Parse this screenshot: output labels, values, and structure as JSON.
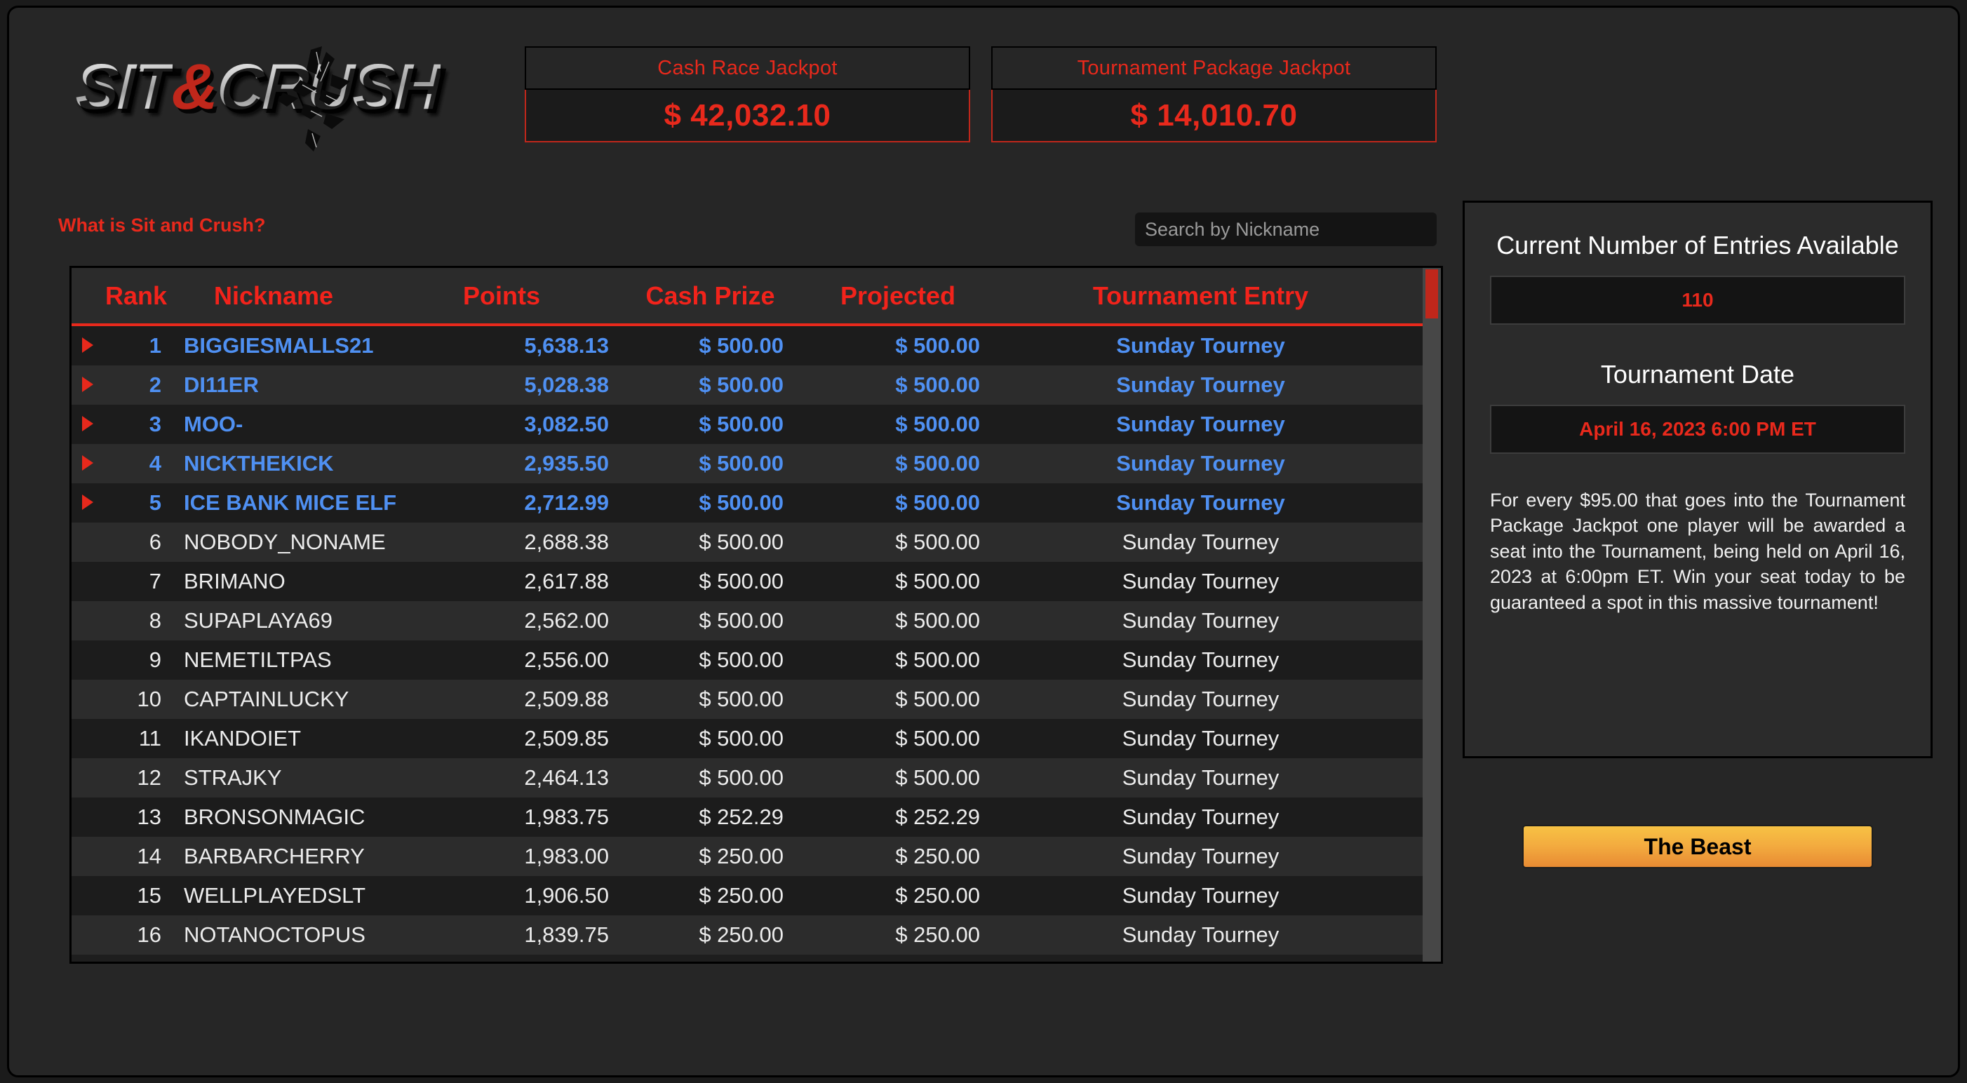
{
  "brand": {
    "logo_part1": "SIT",
    "logo_amp": "&",
    "logo_part2": "CRUSH",
    "logo_alt": "Sit & Crush"
  },
  "jackpots": {
    "cash": {
      "label": "Cash Race Jackpot",
      "value": "$ 42,032.10"
    },
    "tournament": {
      "label": "Tournament Package Jackpot",
      "value": "$ 14,010.70"
    }
  },
  "subbar": {
    "what_link": "What is Sit and Crush?",
    "search_placeholder": "Search by Nickname",
    "search_value": ""
  },
  "leaderboard": {
    "headers": {
      "rank": "Rank",
      "nickname": "Nickname",
      "points": "Points",
      "cash_prize": "Cash Prize",
      "projected": "Projected",
      "tournament_entry": "Tournament Entry"
    },
    "rows": [
      {
        "rank": "1",
        "nickname": "BIGGIESMALLS21",
        "points": "5,638.13",
        "cash": "$ 500.00",
        "projected": "$ 500.00",
        "entry": "Sunday Tourney",
        "highlight": true
      },
      {
        "rank": "2",
        "nickname": "DI11ER",
        "points": "5,028.38",
        "cash": "$ 500.00",
        "projected": "$ 500.00",
        "entry": "Sunday Tourney",
        "highlight": true
      },
      {
        "rank": "3",
        "nickname": "MOO-",
        "points": "3,082.50",
        "cash": "$ 500.00",
        "projected": "$ 500.00",
        "entry": "Sunday Tourney",
        "highlight": true
      },
      {
        "rank": "4",
        "nickname": "NICKTHEKICK",
        "points": "2,935.50",
        "cash": "$ 500.00",
        "projected": "$ 500.00",
        "entry": "Sunday Tourney",
        "highlight": true
      },
      {
        "rank": "5",
        "nickname": "ICE BANK MICE ELF",
        "points": "2,712.99",
        "cash": "$ 500.00",
        "projected": "$ 500.00",
        "entry": "Sunday Tourney",
        "highlight": true
      },
      {
        "rank": "6",
        "nickname": "NOBODY_NONAME",
        "points": "2,688.38",
        "cash": "$ 500.00",
        "projected": "$ 500.00",
        "entry": "Sunday Tourney",
        "highlight": false
      },
      {
        "rank": "7",
        "nickname": "BRIMANO",
        "points": "2,617.88",
        "cash": "$ 500.00",
        "projected": "$ 500.00",
        "entry": "Sunday Tourney",
        "highlight": false
      },
      {
        "rank": "8",
        "nickname": "SUPAPLAYA69",
        "points": "2,562.00",
        "cash": "$ 500.00",
        "projected": "$ 500.00",
        "entry": "Sunday Tourney",
        "highlight": false
      },
      {
        "rank": "9",
        "nickname": "NEMETILTPAS",
        "points": "2,556.00",
        "cash": "$ 500.00",
        "projected": "$ 500.00",
        "entry": "Sunday Tourney",
        "highlight": false
      },
      {
        "rank": "10",
        "nickname": "CAPTAINLUCKY",
        "points": "2,509.88",
        "cash": "$ 500.00",
        "projected": "$ 500.00",
        "entry": "Sunday Tourney",
        "highlight": false
      },
      {
        "rank": "11",
        "nickname": "IKANDOIET",
        "points": "2,509.85",
        "cash": "$ 500.00",
        "projected": "$ 500.00",
        "entry": "Sunday Tourney",
        "highlight": false
      },
      {
        "rank": "12",
        "nickname": "STRAJKY",
        "points": "2,464.13",
        "cash": "$ 500.00",
        "projected": "$ 500.00",
        "entry": "Sunday Tourney",
        "highlight": false
      },
      {
        "rank": "13",
        "nickname": "BRONSONMAGIC",
        "points": "1,983.75",
        "cash": "$ 252.29",
        "projected": "$ 252.29",
        "entry": "Sunday Tourney",
        "highlight": false
      },
      {
        "rank": "14",
        "nickname": "BARBARCHERRY",
        "points": "1,983.00",
        "cash": "$ 250.00",
        "projected": "$ 250.00",
        "entry": "Sunday Tourney",
        "highlight": false
      },
      {
        "rank": "15",
        "nickname": "WELLPLAYEDSLT",
        "points": "1,906.50",
        "cash": "$ 250.00",
        "projected": "$ 250.00",
        "entry": "Sunday Tourney",
        "highlight": false
      },
      {
        "rank": "16",
        "nickname": "NOTANOCTOPUS",
        "points": "1,839.75",
        "cash": "$ 250.00",
        "projected": "$ 250.00",
        "entry": "Sunday Tourney",
        "highlight": false
      }
    ]
  },
  "side_panel": {
    "entries_title": "Current Number of Entries Available",
    "entries_value": "110",
    "date_title": "Tournament Date",
    "date_value": "April 16, 2023 6:00 PM ET",
    "description": "For every $95.00 that goes into the Tournament Package Jackpot one player will be awarded a seat into the Tournament, being held on April 16, 2023 at 6:00pm ET. Win your seat today to be guaranteed a spot in this massive tournament!"
  },
  "beast_button": {
    "label": "The Beast"
  },
  "colors": {
    "accent_red": "#e8291c",
    "highlight_blue": "#4f90f2",
    "page_bg": "#262626",
    "row_odd": "#1c1c1c",
    "row_even": "#2c2c2c",
    "beast_gradient_start": "#f7c244",
    "beast_gradient_end": "#e88b33"
  }
}
